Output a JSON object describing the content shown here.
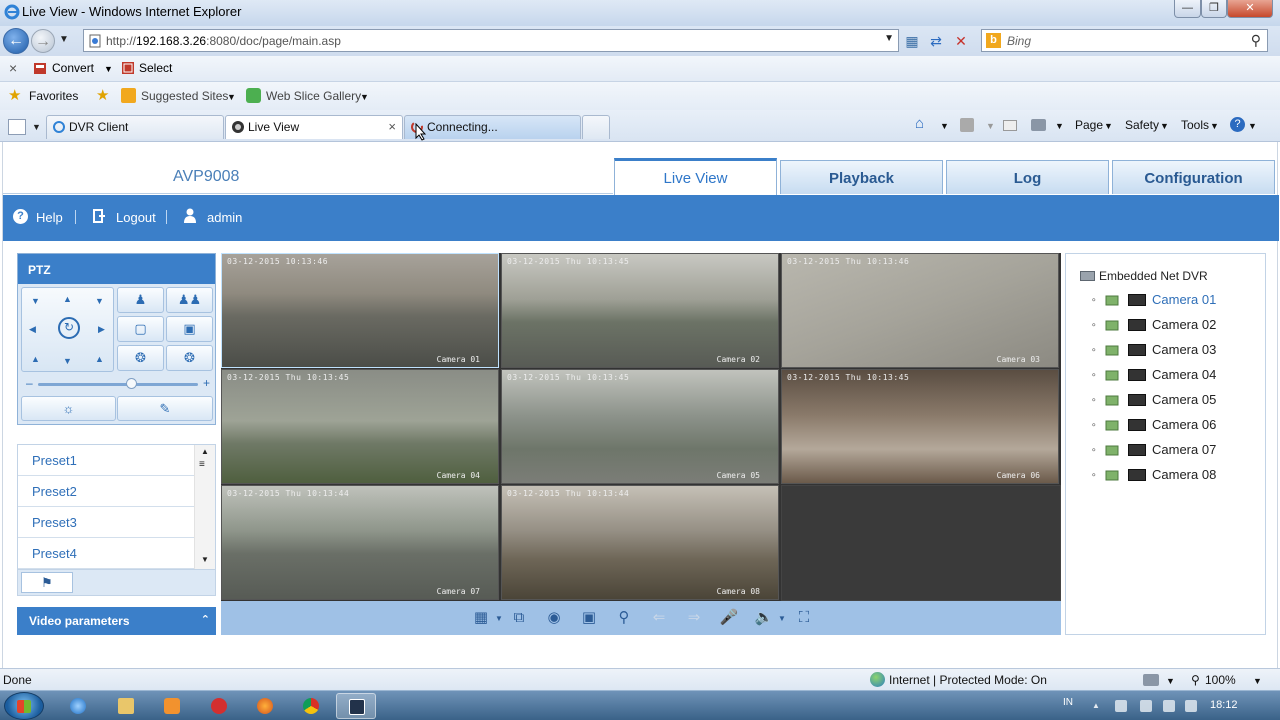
{
  "window": {
    "title": "Live View - Windows Internet Explorer",
    "minimize": "—",
    "maximize": "❐",
    "close": "✕"
  },
  "addressbar": {
    "url_prefix": "http://",
    "url_host": "192.168.3.26",
    "url_rest": ":8080/doc/page/main.asp",
    "search_placeholder": "Bing"
  },
  "commandbar": {
    "convert": "Convert",
    "select": "Select"
  },
  "favorites": {
    "favorites_label": "Favorites",
    "suggested_sites": "Suggested Sites",
    "web_slice_gallery": "Web Slice Gallery"
  },
  "tabs": [
    {
      "label": "DVR Client"
    },
    {
      "label": "Live View"
    },
    {
      "label": "Connecting..."
    }
  ],
  "ie_tools": {
    "page": "Page",
    "safety": "Safety",
    "tools": "Tools"
  },
  "app": {
    "device_name": "AVP9008",
    "nav_tabs": [
      "Live View",
      "Playback",
      "Log",
      "Configuration"
    ],
    "help": "Help",
    "logout": "Logout",
    "user": "admin"
  },
  "ptz": {
    "title": "PTZ",
    "speed_level": 0.58
  },
  "presets": [
    "Preset1",
    "Preset2",
    "Preset3",
    "Preset4"
  ],
  "video_parameters": "Video parameters",
  "cameras": [
    {
      "date": "03-12-2015",
      "time": "10:13:46",
      "name": "Camera 01"
    },
    {
      "date": "03-12-2015 Thu",
      "time": "10:13:45",
      "name": "Camera 02"
    },
    {
      "date": "03-12-2015 Thu",
      "time": "10:13:46",
      "name": "Camera 03"
    },
    {
      "date": "03-12-2015 Thu",
      "time": "10:13:45",
      "name": "Camera 04"
    },
    {
      "date": "03-12-2015 Thu",
      "time": "10:13:45",
      "name": "Camera 05"
    },
    {
      "date": "03-12-2015 Thu",
      "time": "10:13:45",
      "name": "Camera 06"
    },
    {
      "date": "03-12-2015 Thu",
      "time": "10:13:44",
      "name": "Camera 07"
    },
    {
      "date": "03-12-2015 Thu",
      "time": "10:13:44",
      "name": "Camera 08"
    }
  ],
  "tree": {
    "root": "Embedded Net DVR",
    "cameras": [
      "Camera 01",
      "Camera 02",
      "Camera 03",
      "Camera 04",
      "Camera 05",
      "Camera 06",
      "Camera 07",
      "Camera 08"
    ],
    "selected": "Camera 01"
  },
  "statusbar": {
    "left": "Done",
    "zone": "Internet | Protected Mode: On",
    "zoom": "100%"
  },
  "taskbar": {
    "lang": "IN",
    "time": "18:12"
  },
  "colors": {
    "accent": "#3b7fc9",
    "link": "#2f6fb8"
  }
}
